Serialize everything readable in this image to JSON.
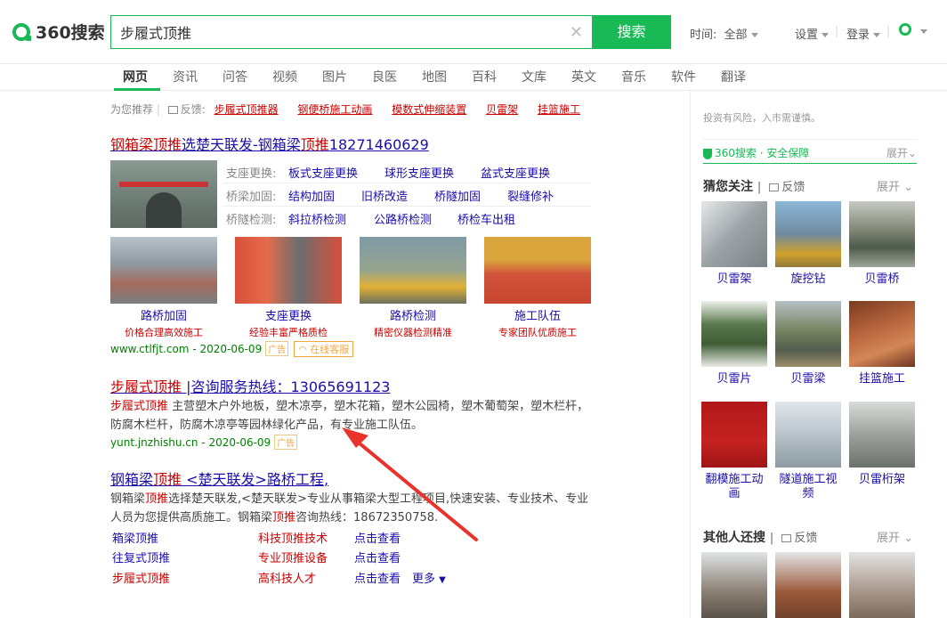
{
  "header": {
    "logo_text": "360搜索",
    "query": "步履式顶推",
    "search_button": "搜索",
    "time_label": "时间:",
    "time_value": "全部",
    "settings": "设置",
    "login": "登录"
  },
  "nav": {
    "items": [
      "网页",
      "资讯",
      "问答",
      "视频",
      "图片",
      "良医",
      "地图",
      "百科",
      "文库",
      "英文",
      "音乐",
      "软件",
      "翻译"
    ],
    "active": "网页"
  },
  "recommend": {
    "label": "为您推荐",
    "feedback": "反馈:",
    "links": [
      "步履式顶推器",
      "钢便桥施工动画",
      "模数式伸缩装置",
      "贝雷架",
      "挂篮施工"
    ]
  },
  "results": [
    {
      "title_prefix": "钢箱梁顶推",
      "title_mid": "选楚天联发-钢箱梁",
      "title_hl": "顶推",
      "title_suffix": "18271460629",
      "sublinks": [
        {
          "label": "支座更换:",
          "links": [
            "板式支座更换",
            "球形支座更换",
            "盆式支座更换"
          ]
        },
        {
          "label": "桥梁加固:",
          "links": [
            "结构加固",
            "旧桥改造",
            "桥隧加固",
            "裂缝修补"
          ]
        },
        {
          "label": "桥隧检测:",
          "links": [
            "斜拉桥检测",
            "公路桥检测",
            "桥检车出租"
          ]
        }
      ],
      "images": [
        {
          "caption": "路桥加固",
          "sub": "价格合理高效施工"
        },
        {
          "caption": "支座更换",
          "sub": "经验丰富严格质检"
        },
        {
          "caption": "路桥检测",
          "sub": "精密仪器检测精准"
        },
        {
          "caption": "施工队伍",
          "sub": "专家团队优质施工"
        }
      ],
      "url": "www.ctlfjt.com - 2020-06-09",
      "ad": "广告",
      "online": "在线客服"
    },
    {
      "title_hl": "步履式顶推",
      "title_rest": " |咨询服务热线：13065691123",
      "desc_line1_hl": "步履式顶推",
      "desc_line1": " 主营塑木户外地板，塑木凉亭，塑木花箱，塑木公园椅，塑木葡萄架，塑木栏杆，",
      "desc_line2": "防腐木栏杆，防腐木凉亭等园林绿化产品，有专业施工队伍。",
      "url": "yunt.jnzhishu.cn - 2020-06-09",
      "ad": "广告"
    },
    {
      "title_a": "钢箱梁",
      "title_hl": "顶推",
      "title_b": " <楚天联发>路桥工程",
      "title_c": ",",
      "desc_a": "钢箱梁",
      "desc_hl1": "顶推",
      "desc_b": "选择楚天联发,<楚天联发>专业从事箱梁大型工程项目,快速安装、专业技术、专业",
      "desc_c": "人员为您提供高质施工。钢箱梁",
      "desc_hl2": "顶推",
      "desc_d": "咨询热线：18672350758.",
      "grid": [
        [
          "箱梁顶推",
          "科技顶推技术",
          "点击查看"
        ],
        [
          "往复式顶推",
          "专业顶推设备",
          "点击查看"
        ],
        [
          "步履式顶推",
          "高科技人才",
          "点击查看"
        ]
      ],
      "more": "更多"
    }
  ],
  "sidebar": {
    "risk": "投资有风险，入市需谨慎。",
    "safe": "360搜索 · 安全保障",
    "expand": "展开",
    "guess_title": "猜您关注",
    "feedback": "反馈",
    "guess_items": [
      "贝雷架",
      "旋挖钻",
      "贝雷桥",
      "贝雷片",
      "贝雷梁",
      "挂篮施工",
      "翻模施工动画",
      "隧道施工视频",
      "贝雷桁架"
    ],
    "others_title": "其他人还搜"
  },
  "colors": {
    "brand_green": "#19b955",
    "link_blue": "#1a0dab",
    "highlight_red": "#cc0000",
    "url_green": "#008000"
  }
}
